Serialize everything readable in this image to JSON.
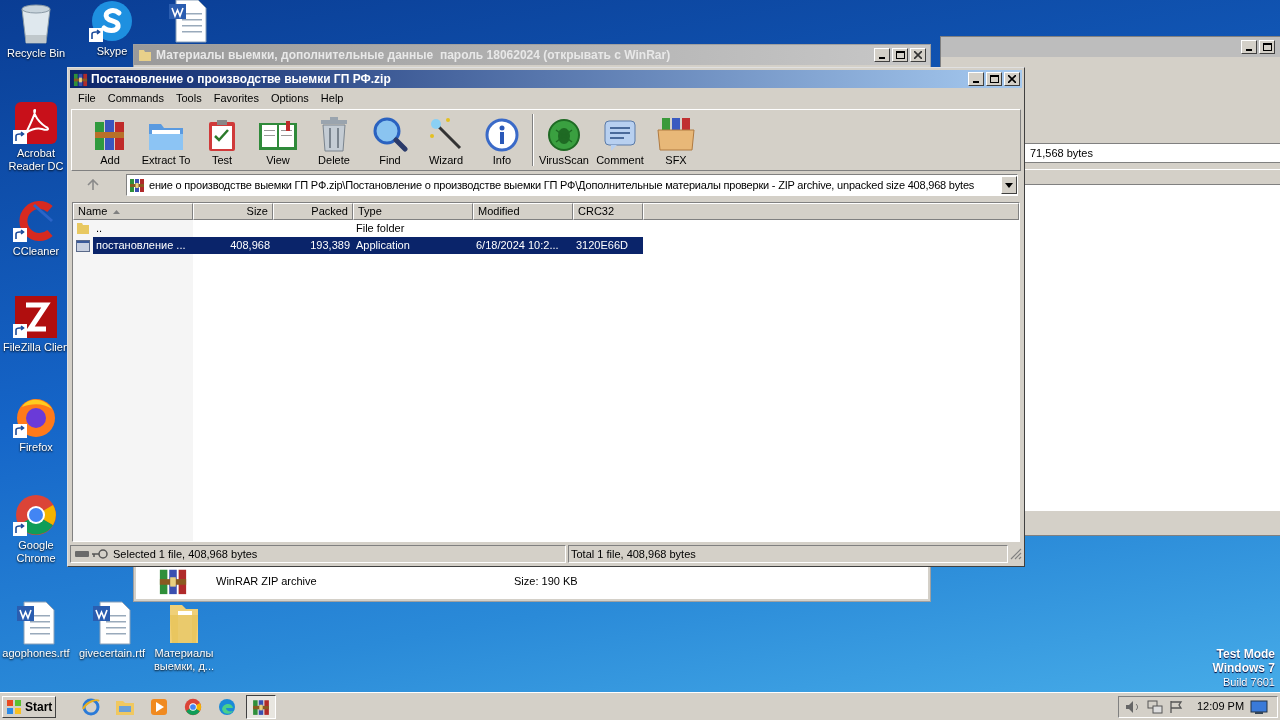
{
  "desktop_icons": [
    {
      "label": "Recycle Bin",
      "kind": "bin",
      "shortcut": false
    },
    {
      "label": "Skype",
      "kind": "skype",
      "shortcut": true
    },
    {
      "kind": "document",
      "shortcut": false
    },
    {
      "label": "Acrobat Reader DC",
      "kind": "acrobat",
      "shortcut": true
    },
    {
      "label": "CCleaner",
      "kind": "ccleaner",
      "shortcut": true
    },
    {
      "label": "FileZilla Clien",
      "kind": "filezilla",
      "shortcut": true
    },
    {
      "label": "Firefox",
      "kind": "firefox",
      "shortcut": true
    },
    {
      "label": "Google Chrome",
      "kind": "chrome",
      "shortcut": true
    },
    {
      "label": "agophones.rtf",
      "kind": "document",
      "shortcut": false
    },
    {
      "label": "givecertain.rtf",
      "kind": "document",
      "shortcut": false
    },
    {
      "label": "Материалы выемки, д...",
      "kind": "folder",
      "shortcut": false
    }
  ],
  "right_window": {
    "field_text": "71,568 bytes"
  },
  "folder_window": {
    "title": "Материалы выемки, дополнительные данные  пароль 18062024 (открывать с WinRar)",
    "item": {
      "name": "WinRAR ZIP archive",
      "size": "Size: 190 KB"
    }
  },
  "archive_window": {
    "title": "Постановление о производстве выемки ГП РФ.zip",
    "menu": [
      "File",
      "Commands",
      "Tools",
      "Favorites",
      "Options",
      "Help"
    ],
    "toolbar": [
      {
        "label": "Add",
        "kind": "add"
      },
      {
        "label": "Extract To",
        "kind": "extract"
      },
      {
        "label": "Test",
        "kind": "test"
      },
      {
        "label": "View",
        "kind": "view"
      },
      {
        "label": "Delete",
        "kind": "delete"
      },
      {
        "label": "Find",
        "kind": "find"
      },
      {
        "label": "Wizard",
        "kind": "wizard"
      },
      {
        "label": "Info",
        "kind": "info"
      },
      {
        "label": "VirusScan",
        "kind": "virusscan"
      },
      {
        "label": "Comment",
        "kind": "comment"
      },
      {
        "label": "SFX",
        "kind": "sfx"
      }
    ],
    "address": "ение о производстве выемки ГП РФ.zip\\Постановление о производстве выемки ГП РФ\\Дополнительные материалы проверки - ZIP archive, unpacked size 408,968 bytes",
    "columns": [
      {
        "label": "Name",
        "sorted": true
      },
      {
        "label": "Size",
        "sorted": false
      },
      {
        "label": "Packed",
        "sorted": false
      },
      {
        "label": "Type",
        "sorted": false
      },
      {
        "label": "Modified",
        "sorted": false
      },
      {
        "label": "CRC32",
        "sorted": false
      }
    ],
    "rows": [
      {
        "kind": "folder",
        "name": "..",
        "type": "File folder",
        "selected": false
      },
      {
        "kind": "application",
        "name": "постановление ...",
        "size": "408,968",
        "packed": "193,389",
        "type": "Application",
        "modified": "6/18/2024 10:2...",
        "crc32": "3120E66D",
        "selected": true
      }
    ],
    "status_left": "Selected 1 file, 408,968 bytes",
    "status_right": "Total 1 file, 408,968 bytes"
  },
  "taskbar": {
    "start": "Start",
    "apps": [
      {
        "kind": "ie",
        "selected": false
      },
      {
        "kind": "explorer",
        "selected": false
      },
      {
        "kind": "media",
        "selected": false
      },
      {
        "kind": "chrome",
        "selected": false
      },
      {
        "kind": "edge",
        "selected": false
      },
      {
        "kind": "winrar",
        "selected": true
      }
    ],
    "clock": "12:09 PM"
  },
  "test_mode": [
    "Test Mode",
    "Windows 7",
    "Build 7601"
  ]
}
